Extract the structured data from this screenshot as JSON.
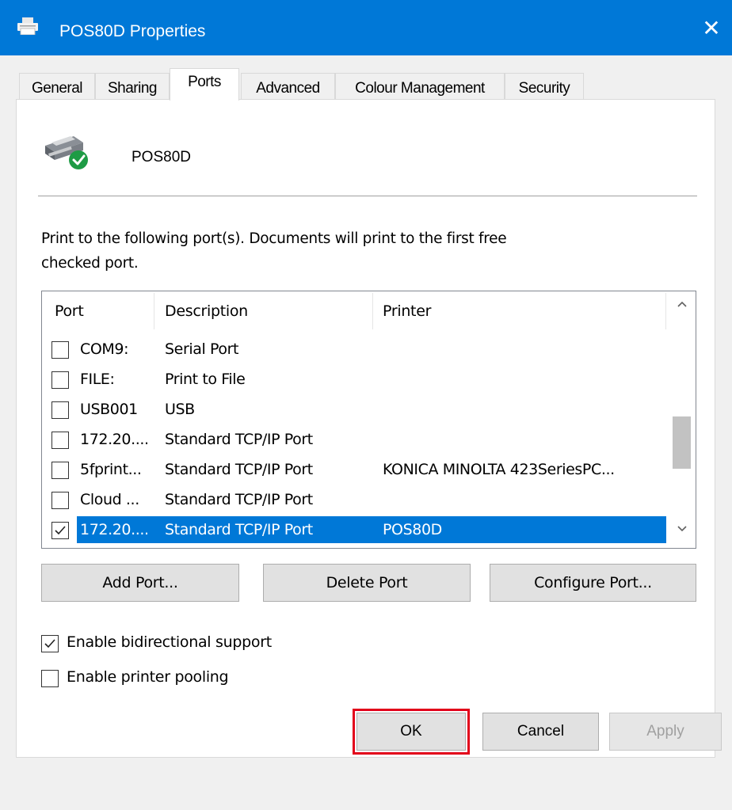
{
  "window": {
    "title": "POS80D Properties",
    "close_glyph": "✕",
    "accent": "#0078d7"
  },
  "tabs": [
    {
      "label": "General",
      "active": false
    },
    {
      "label": "Sharing",
      "active": false
    },
    {
      "label": "Ports",
      "active": true
    },
    {
      "label": "Advanced",
      "active": false
    },
    {
      "label": "Colour Management",
      "active": false
    },
    {
      "label": "Security",
      "active": false
    }
  ],
  "ports_page": {
    "printer_name": "POS80D",
    "intro_line1": "Print to the following port(s). Documents will print to the first free",
    "intro_line2": "checked port.",
    "columns": {
      "port": "Port",
      "description": "Description",
      "printer": "Printer"
    },
    "rows": [
      {
        "port": "COM9:",
        "description": "Serial Port",
        "printer": "",
        "checked": false,
        "selected": false
      },
      {
        "port": "FILE:",
        "description": "Print to File",
        "printer": "",
        "checked": false,
        "selected": false
      },
      {
        "port": "USB001",
        "description": "USB",
        "printer": "",
        "checked": false,
        "selected": false
      },
      {
        "port": "172.20....",
        "description": "Standard TCP/IP Port",
        "printer": "",
        "checked": false,
        "selected": false
      },
      {
        "port": "5fprint...",
        "description": "Standard TCP/IP Port",
        "printer": "KONICA MINOLTA 423SeriesPC...",
        "checked": false,
        "selected": false
      },
      {
        "port": "Cloud ...",
        "description": "Standard TCP/IP Port",
        "printer": "",
        "checked": false,
        "selected": false
      },
      {
        "port": "172.20....",
        "description": "Standard TCP/IP Port",
        "printer": "POS80D",
        "checked": true,
        "selected": true
      }
    ],
    "buttons": {
      "add_port": "Add Port...",
      "delete_port": "Delete Port",
      "configure_port": "Configure Port..."
    },
    "options": {
      "bidirectional": {
        "label": "Enable bidirectional support",
        "checked": true
      },
      "pooling": {
        "label": "Enable printer pooling",
        "checked": false
      }
    }
  },
  "footer": {
    "ok": "OK",
    "cancel": "Cancel",
    "apply": "Apply",
    "highlight_color": "#e2001a"
  }
}
